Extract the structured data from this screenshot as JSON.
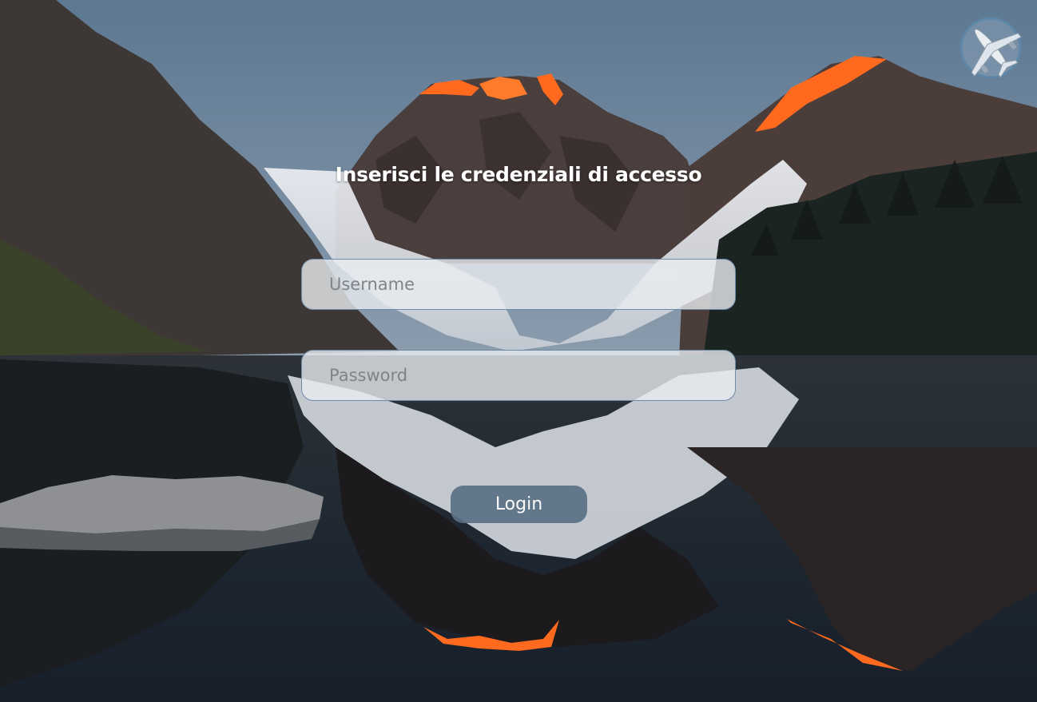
{
  "login": {
    "title": "Inserisci le credenziali di accesso",
    "username_placeholder": "Username",
    "username_value": "",
    "password_placeholder": "Password",
    "password_value": "",
    "login_label": "Login"
  },
  "icons": {
    "logo": "airplane-icon"
  },
  "colors": {
    "sky": "#6e8499",
    "field_border": "#6d8ba9",
    "button": "#5a7184",
    "alpenglow": "#ff6a1f",
    "title_text": "#ffffff"
  }
}
